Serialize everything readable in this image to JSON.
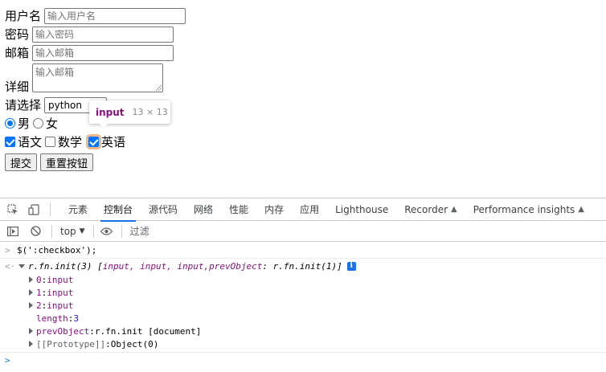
{
  "form": {
    "username_label": "用户名",
    "username_placeholder": "输入用户名",
    "password_label": "密码",
    "password_placeholder": "输入密码",
    "email_label": "邮箱",
    "email_placeholder": "输入邮箱",
    "detail_label": "详细",
    "detail_placeholder": "输入邮箱",
    "select_label": "请选择",
    "select_value": "python",
    "gender": [
      {
        "label": "男",
        "checked": true
      },
      {
        "label": "女",
        "checked": false
      }
    ],
    "subjects": [
      {
        "label": "语文",
        "checked": true
      },
      {
        "label": "数学",
        "checked": false
      },
      {
        "label": "英语",
        "checked": true
      }
    ],
    "submit_label": "提交",
    "reset_label": "重置按钮"
  },
  "tooltip": {
    "tag": "input",
    "size": "13 × 13"
  },
  "devtools": {
    "tabs": [
      "元素",
      "控制台",
      "源代码",
      "网络",
      "性能",
      "内存",
      "应用",
      "Lighthouse",
      "Recorder",
      "Performance insights"
    ],
    "active_tab": "控制台",
    "context": "top",
    "filter_placeholder": "过滤",
    "console": {
      "command": "$(':checkbox');",
      "result_prefix": "r.fn.init(3) [",
      "result_items": "input, input, input, ",
      "result_prev_key": "prevObject",
      "result_prev_val": ": r.fn.init(1)]",
      "entries": [
        {
          "key": "0",
          "value": "input"
        },
        {
          "key": "1",
          "value": "input"
        },
        {
          "key": "2",
          "value": "input"
        }
      ],
      "length_key": "length",
      "length_value": "3",
      "prev_key": "prevObject",
      "prev_value": "r.fn.init [document]",
      "proto_key": "[[Prototype]]",
      "proto_value": "Object(0)"
    }
  },
  "icons": {
    "inspect": "inspect-icon",
    "device": "device-toggle-icon",
    "sidebar": "sidebar-toggle-icon",
    "clear": "clear-console-icon",
    "eye": "eye-icon",
    "flask": "experiment-flask-icon",
    "info": "info-icon"
  }
}
